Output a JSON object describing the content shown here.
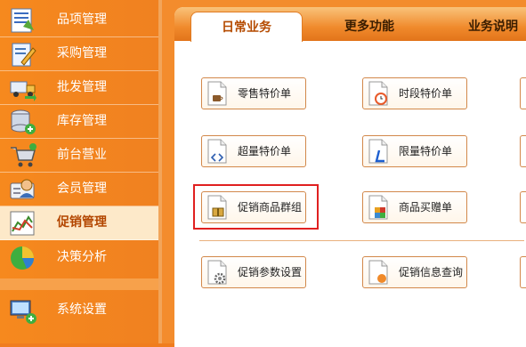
{
  "sidebar": {
    "items": [
      {
        "label": "品项管理",
        "icon": "product-list-icon"
      },
      {
        "label": "采购管理",
        "icon": "purchase-notepad-icon"
      },
      {
        "label": "批发管理",
        "icon": "wholesale-truck-icon"
      },
      {
        "label": "库存管理",
        "icon": "inventory-database-icon"
      },
      {
        "label": "前台营业",
        "icon": "front-desk-cart-icon"
      },
      {
        "label": "会员管理",
        "icon": "member-card-icon"
      },
      {
        "label": "促销管理",
        "icon": "promotion-chart-icon",
        "active": true
      },
      {
        "label": "决策分析",
        "icon": "pie-chart-icon"
      },
      {
        "label": "系统设置",
        "icon": "system-computer-icon"
      }
    ]
  },
  "tabs": [
    {
      "label": "日常业务",
      "active": true
    },
    {
      "label": "更多功能"
    },
    {
      "label": "业务说明"
    }
  ],
  "buttons": [
    {
      "label": "零售特价单",
      "icon": "coffee-cup-doc-icon"
    },
    {
      "label": "时段特价单",
      "icon": "alarm-clock-doc-icon"
    },
    {
      "label": "超量特价单",
      "icon": "code-arrows-doc-icon"
    },
    {
      "label": "限量特价单",
      "icon": "letter-l-doc-icon"
    },
    {
      "label": "促销商品群组",
      "icon": "gift-box-doc-icon"
    },
    {
      "label": "商品买赠单",
      "icon": "color-blocks-doc-icon"
    },
    {
      "label": "促销参数设置",
      "icon": "gear-doc-icon"
    },
    {
      "label": "促销信息查询",
      "icon": "orange-circle-doc-icon"
    }
  ],
  "colors": {
    "sidebar_bg": "#f6891e",
    "active_bg": "#fde9c9",
    "accent": "#b54b00",
    "highlight_border": "#e02020"
  }
}
